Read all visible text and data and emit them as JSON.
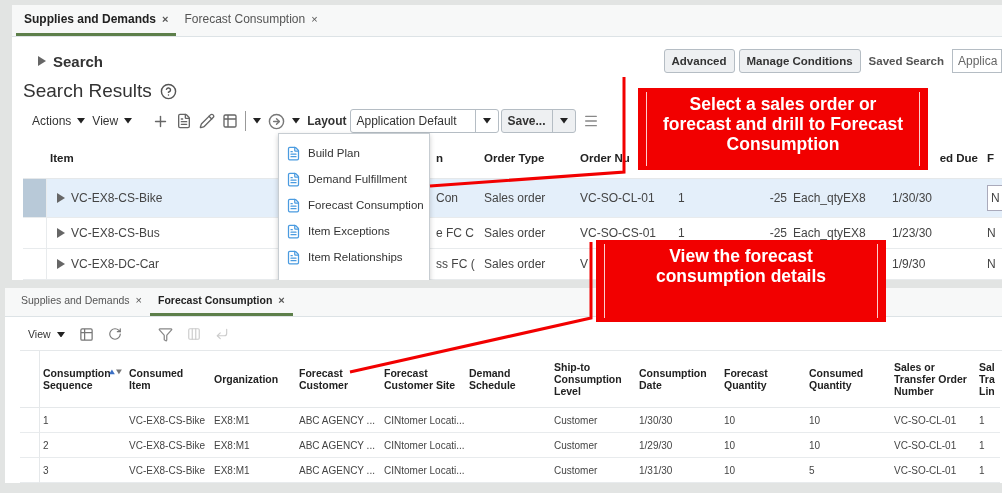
{
  "top_window": {
    "tabs": [
      {
        "label": "Supplies and Demands",
        "close": "×",
        "selected": true
      },
      {
        "label": "Forecast Consumption",
        "close": "×",
        "selected": false
      }
    ],
    "search": {
      "label": "Search",
      "expanded": false
    },
    "buttons": [
      "Advanced",
      "Manage Conditions"
    ],
    "saved_search": {
      "label": "Saved Search",
      "value": "Applica"
    },
    "title": "Search Results",
    "toolbar": {
      "menus": [
        "Actions",
        "View"
      ],
      "layout_label": "Layout",
      "layout_value": "Application Default",
      "save_label": "Save..."
    },
    "table": {
      "columns": [
        "Item",
        "n",
        "Order Type",
        "Order Nu",
        "ed Due",
        "F"
      ],
      "rows": [
        {
          "item": "VC-EX8-CS-Bike",
          "selected": true,
          "column_3": "Con",
          "order_type": "Sales order",
          "order_number": "VC-SO-CL-01",
          "column_6": "1",
          "column_7": "-25",
          "column_8": "Each_qtyEX8",
          "column_9": "1/30/30",
          "column_10": "N"
        },
        {
          "item": "VC-EX8-CS-Bus",
          "selected": false,
          "column_3": "e FC C",
          "order_type": "Sales order",
          "order_number": "VC-SO-CS-01",
          "column_6": "1",
          "column_7": "-25",
          "column_8": "Each_qtyEX8",
          "column_9": "1/23/30",
          "column_10": "N"
        },
        {
          "item": "VC-EX8-DC-Car",
          "selected": false,
          "column_3": "ss FC (",
          "order_type": "Sales order",
          "order_number": "V",
          "column_9": "1/9/30",
          "column_10": "N"
        }
      ]
    },
    "menu": {
      "items": [
        "Build Plan",
        "Demand Fulfillment",
        "Forecast Consumption",
        "Item Exceptions",
        "Item Relationships"
      ]
    }
  },
  "bottom_window": {
    "tabs": [
      {
        "label": "Supplies and Demands",
        "close": "×",
        "selected": false
      },
      {
        "label": "Forecast Consumption",
        "close": "×",
        "selected": true
      }
    ],
    "toolbar": {
      "menus": [
        "View"
      ]
    },
    "table": {
      "columns": [
        "Consumption Sequence",
        "Consumed Item",
        "Organization",
        "Forecast Customer",
        "Forecast Customer Site",
        "Demand Schedule",
        "Ship-to Consumption Level",
        "Consumption Date",
        "Forecast Quantity",
        "Consumed Quantity",
        "Sales or Transfer Order Number",
        "Sal Tra Lin"
      ],
      "rows": [
        [
          "1",
          "VC-EX8-CS-Bike",
          "EX8:M1",
          "ABC AGENCY ...",
          "CINtomer Locati...",
          "",
          "Customer",
          "1/30/30",
          "10",
          "10",
          "VC-SO-CL-01",
          "1"
        ],
        [
          "2",
          "VC-EX8-CS-Bike",
          "EX8:M1",
          "ABC AGENCY ...",
          "CINtomer Locati...",
          "",
          "Customer",
          "1/29/30",
          "10",
          "10",
          "VC-SO-CL-01",
          "1"
        ],
        [
          "3",
          "VC-EX8-CS-Bike",
          "EX8:M1",
          "ABC AGENCY ...",
          "CINtomer Locati...",
          "",
          "Customer",
          "1/31/30",
          "10",
          "5",
          "VC-SO-CL-01",
          "1"
        ]
      ]
    }
  },
  "callouts": [
    {
      "text": "Select a sales order or forecast and drill to Forecast Consumption"
    },
    {
      "text": "View the forecast consumption details"
    }
  ]
}
